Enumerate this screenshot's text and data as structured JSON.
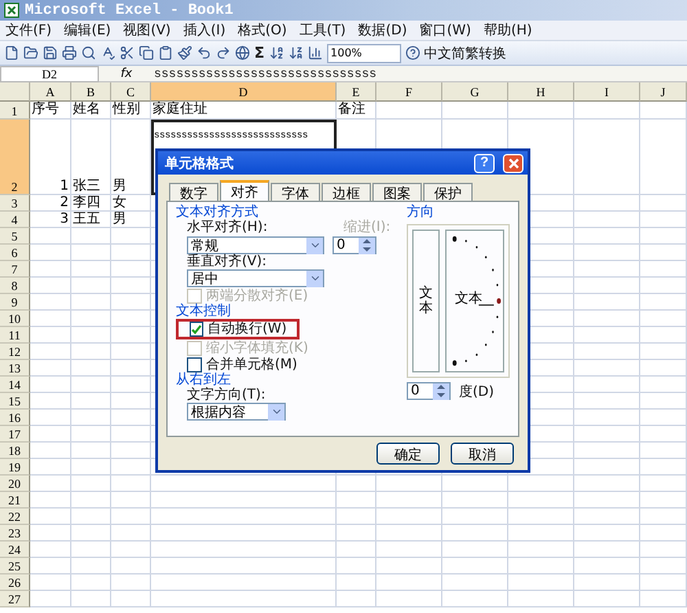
{
  "window": {
    "title": "Microsoft Excel - Book1"
  },
  "menu": [
    "文件(F)",
    "编辑(E)",
    "视图(V)",
    "插入(I)",
    "格式(O)",
    "工具(T)",
    "数据(D)",
    "窗口(W)",
    "帮助(H)"
  ],
  "toolbar": {
    "sigma": "Σ",
    "zoom": "100%",
    "convert": "中文简繁转换"
  },
  "formula_bar": {
    "name_box": "D2",
    "fx": "fx",
    "value": "ssssssssssssssssssssssssssssss"
  },
  "columns": [
    {
      "label": "A",
      "selected": false
    },
    {
      "label": "B",
      "selected": false
    },
    {
      "label": "C",
      "selected": false
    },
    {
      "label": "D",
      "selected": true
    },
    {
      "label": "E",
      "selected": false
    },
    {
      "label": "F",
      "selected": false
    },
    {
      "label": "G",
      "selected": false
    },
    {
      "label": "H",
      "selected": false
    },
    {
      "label": "I",
      "selected": false
    },
    {
      "label": "J",
      "selected": false
    }
  ],
  "rows": [
    {
      "header": "1",
      "selected": false,
      "tall": false,
      "cells": [
        "序号",
        "姓名",
        "性别",
        "家庭住址",
        "备注"
      ]
    },
    {
      "header": "2",
      "selected": true,
      "tall": true,
      "cells": [
        "1",
        "张三",
        "男",
        "ssssssssssssssssssssssssssss"
      ]
    },
    {
      "header": "3",
      "selected": false,
      "tall": false,
      "cells": [
        "2",
        "李四",
        "女"
      ]
    },
    {
      "header": "4",
      "selected": false,
      "tall": false,
      "cells": [
        "3",
        "王五",
        "男"
      ]
    },
    {
      "header": "5",
      "selected": false,
      "tall": false
    },
    {
      "header": "6",
      "selected": false,
      "tall": false
    },
    {
      "header": "7",
      "selected": false,
      "tall": false
    },
    {
      "header": "8",
      "selected": false,
      "tall": false
    },
    {
      "header": "9",
      "selected": false,
      "tall": false
    },
    {
      "header": "10",
      "selected": false,
      "tall": false
    },
    {
      "header": "11",
      "selected": false,
      "tall": false
    },
    {
      "header": "12",
      "selected": false,
      "tall": false
    },
    {
      "header": "13",
      "selected": false,
      "tall": false
    },
    {
      "header": "14",
      "selected": false,
      "tall": false
    },
    {
      "header": "15",
      "selected": false,
      "tall": false
    },
    {
      "header": "16",
      "selected": false,
      "tall": false
    },
    {
      "header": "17",
      "selected": false,
      "tall": false
    },
    {
      "header": "18",
      "selected": false,
      "tall": false
    },
    {
      "header": "19",
      "selected": false,
      "tall": false
    },
    {
      "header": "20",
      "selected": false,
      "tall": false
    },
    {
      "header": "21",
      "selected": false,
      "tall": false
    },
    {
      "header": "22",
      "selected": false,
      "tall": false
    },
    {
      "header": "23",
      "selected": false,
      "tall": false
    },
    {
      "header": "24",
      "selected": false,
      "tall": false
    },
    {
      "header": "25",
      "selected": false,
      "tall": false
    },
    {
      "header": "26",
      "selected": false,
      "tall": false
    },
    {
      "header": "27",
      "selected": false,
      "tall": false
    }
  ],
  "dialog": {
    "title": "单元格格式",
    "help": "?",
    "tabs": [
      {
        "label": "数字",
        "selected": false
      },
      {
        "label": "对齐",
        "selected": true
      },
      {
        "label": "字体",
        "selected": false
      },
      {
        "label": "边框",
        "selected": false
      },
      {
        "label": "图案",
        "selected": false
      },
      {
        "label": "保护",
        "selected": false
      }
    ],
    "alignment": {
      "heading": "文本对齐方式",
      "horizontal": {
        "label": "水平对齐(H):",
        "value": "常规"
      },
      "indent": {
        "label": "缩进(I):",
        "value": "0",
        "disabled": true
      },
      "vertical": {
        "label": "垂直对齐(V):",
        "value": "居中"
      },
      "distributed": {
        "label": "两端分散对齐(E)",
        "checked": false,
        "disabled": true
      }
    },
    "text_control": {
      "heading": "文本控制",
      "options": [
        {
          "label": "自动换行(W)",
          "checked": true,
          "disabled": false,
          "highlighted": true
        },
        {
          "label": "缩小字体填充(K)",
          "checked": false,
          "disabled": true,
          "highlighted": false
        },
        {
          "label": "合并单元格(M)",
          "checked": false,
          "disabled": false,
          "highlighted": false
        }
      ]
    },
    "rtl": {
      "heading": "从右到左",
      "direction": {
        "label": "文字方向(T):",
        "value": "根据内容"
      }
    },
    "orientation": {
      "heading": "方向",
      "vertical_text": "文本",
      "dial_text": "文本",
      "degrees": "0",
      "unit": "度(D)"
    },
    "buttons": [
      "确定",
      "取消"
    ]
  }
}
